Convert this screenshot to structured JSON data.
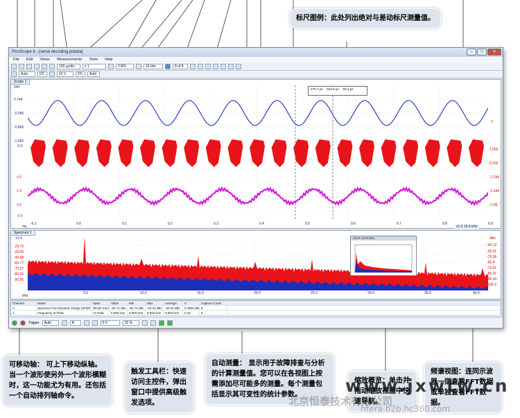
{
  "window": {
    "title": "PicoScope 6 - [serial decoding.psdata]",
    "menu": [
      "File",
      "Edit",
      "Views",
      "Measurements",
      "Tools",
      "Help"
    ],
    "toolbar": {
      "timebase": "100 µs/div",
      "multiplier": "x 1",
      "samples": "2 MS",
      "captures": "16 bits",
      "buffer": "8 of 8",
      "channel_a_range": "Auto",
      "channel_a_coupling": "DC",
      "channel_b_range": "±2 V",
      "channel_b_coupling": "DC",
      "channel_c": "Auto"
    },
    "scope_tab": "Scope 1",
    "spectrum_tab": "Spectrum 1",
    "scope_left_labels": [
      "544",
      "0.744",
      "-0.056",
      "-0.856",
      "-1.656",
      "-2.0",
      "4.0",
      "2.4",
      "0.8",
      "-0.8"
    ],
    "scope_right_labels": [
      "V",
      "1.556",
      "0.156",
      "-1.244",
      "-1.644",
      "-1.99"
    ],
    "scope_x_labels": [
      "-0.1",
      "0.0",
      "0.1",
      "0.2",
      "0.3",
      "0.4",
      "0.5",
      "0.6",
      "0.7",
      "0.8",
      "0.9"
    ],
    "scope_x_unit": "ms",
    "scope_zoom": "x1.0  15.9 kHz",
    "spectrum_left_labels": [
      "13.4",
      "-29.73",
      "-39.43",
      "-49.68",
      "-60.77",
      "-70.27",
      "-80.26",
      "-90.85"
    ],
    "spectrum_right_labels": [
      "-45.13",
      "-65.01",
      "-75.38",
      "-65.4",
      "-70.01",
      "-85.31",
      "-96.43",
      "-106.2"
    ],
    "spectrum_right_unit": "dBu",
    "spectrum_x_labels": [
      "5.0",
      "10.0",
      "15.0",
      "20.0",
      "25.0",
      "30.0",
      "35.0",
      "40.0"
    ],
    "spectrum_x_unit": "kHz",
    "ruler_legend": [
      "470.7 µs",
      "524.8 µs",
      "53.3 µs"
    ],
    "zoom_overview_title": "Zoom Overview",
    "measurements": {
      "headers": [
        "Channel",
        "Name",
        "Span",
        "Value",
        "Min",
        "Max",
        "Average",
        "σ",
        "Capture Count"
      ],
      "rows": [
        [
          "A",
          "Spurious Free Dynamic Range (SFDR)",
          "Whole trace",
          "-64.74 dBc",
          "-64.74 dBc",
          "-62.23 dBc",
          "-63.44 dBc",
          "0.4825 dBc",
          "8"
        ],
        [
          "A",
          "Frequency at Peak",
          "At Peak",
          "9.993 kHz",
          "9.993 kHz",
          "9.993 kHz",
          "9.993 kHz",
          "0 Hz",
          "8"
        ]
      ]
    },
    "bottom": {
      "trigger_label": "Trigger",
      "trigger_mode": "Auto",
      "trigger_source": "A",
      "trigger_level": "0 V",
      "trigger_pre": "10 %"
    }
  },
  "callouts": {
    "ruler_legend": "标尺图例：此处列出绝对与差动标尺测量值。",
    "movable_axes": "可移动轴： 可上下移动纵轴。当一个波形使另外一个波形模糊时，这一功能尤为有用。还包括一个自动排列轴命令。",
    "trigger_toolbar": "触发工具栏：快速访问主控件，弹出窗口中提供高级触发选项。",
    "auto_measurements": "自动测量： 显示用于故障排查与分析的计算测量值。您可以在各视图上按需添加尽可能多的测量。每个测量包括显示其可变性的统计参数。",
    "zoom_overview": "缩放概览：单击并拖动缩放视图中快速导航。",
    "spectrum_view": "频谱视图：连同示波器一同查看FFT数据或单独查看FFT数据。"
  },
  "watermark": {
    "line1": "www.jxwtw.cn",
    "line2": "北京恒泰技术有限公司",
    "line3": "htera.b2b.hc360.com"
  },
  "colors": {
    "ch_a": "#1c2fb8",
    "ch_b": "#e8141a",
    "ch_c": "#d21fd6"
  }
}
